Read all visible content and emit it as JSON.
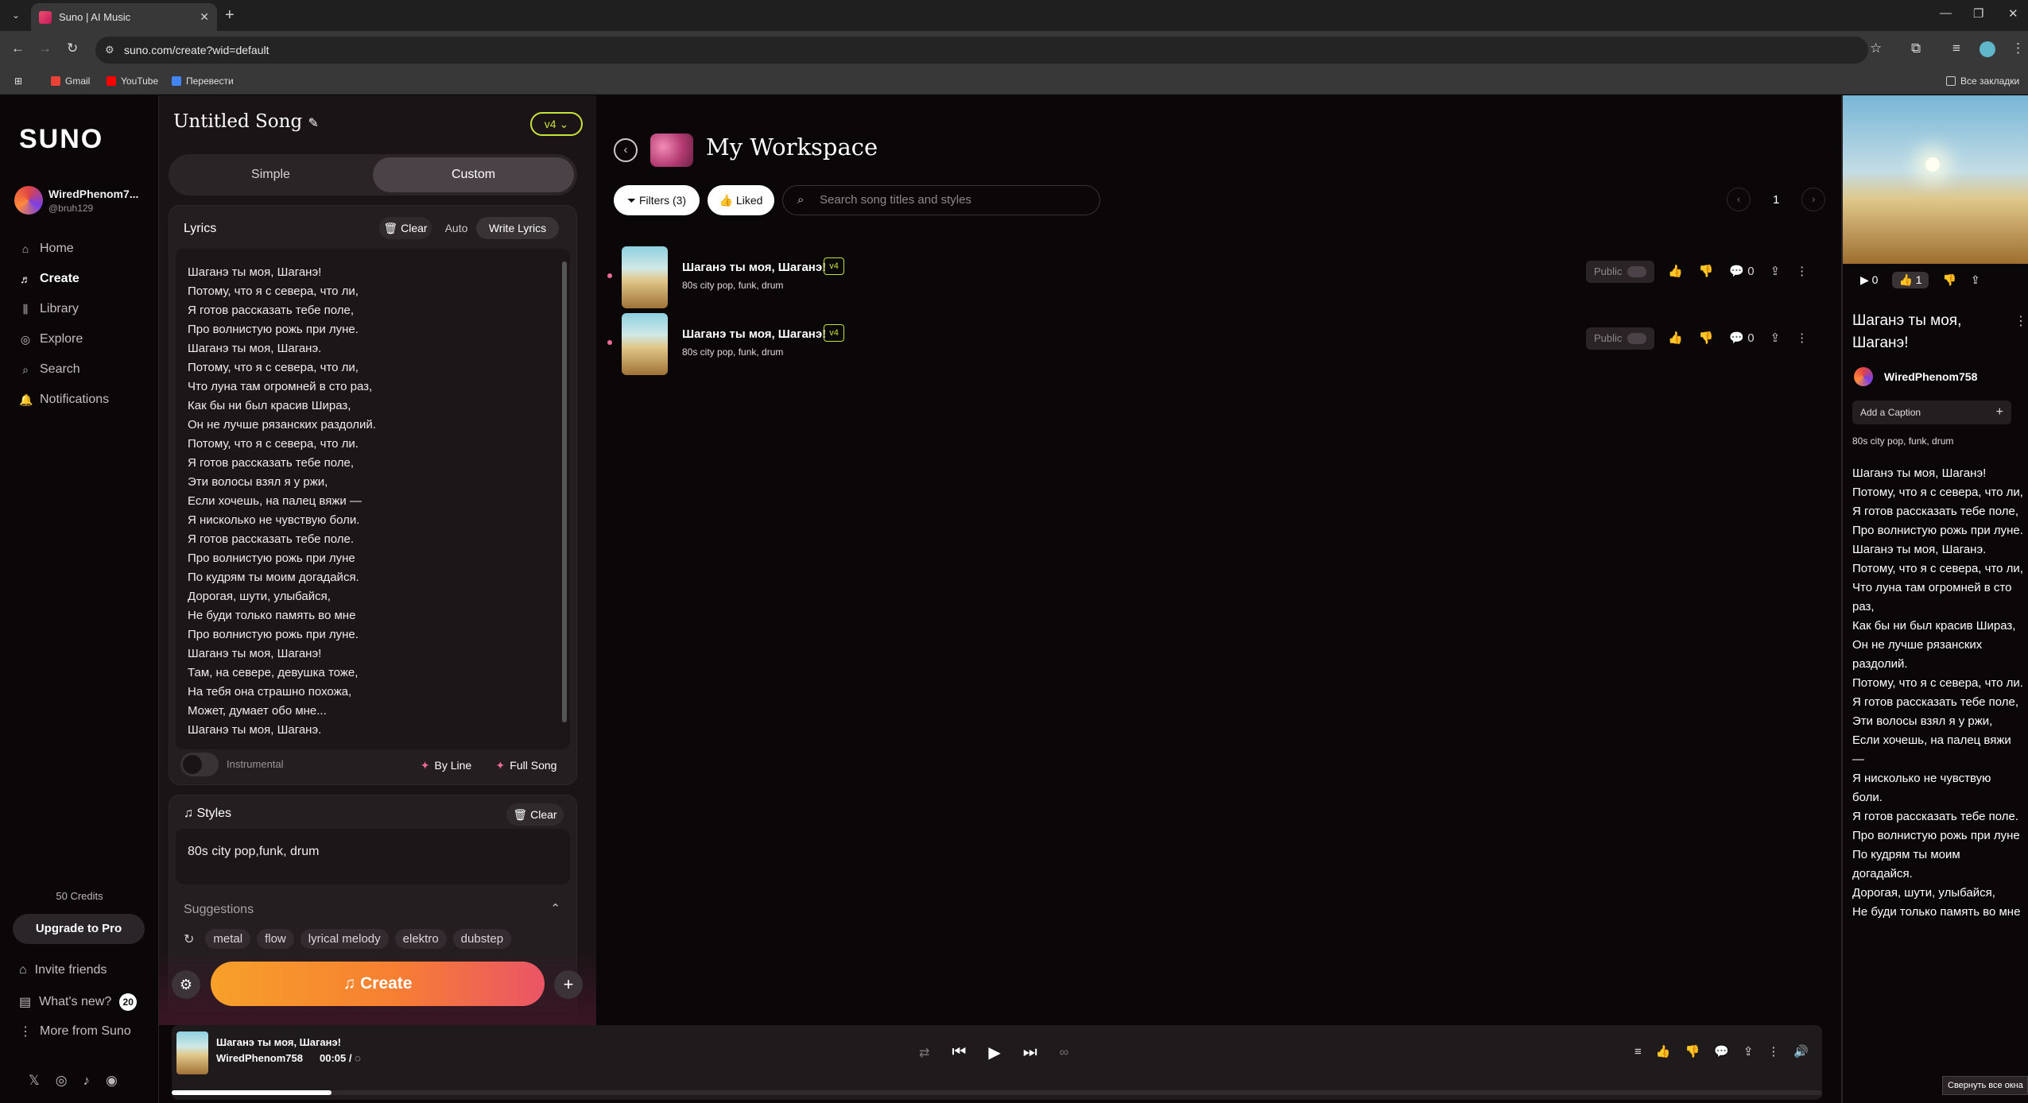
{
  "browser": {
    "tab_title": "Suno | AI Music",
    "tab_close": "✕",
    "new_tab": "+",
    "url": "suno.com/create?wid=default",
    "bookmarks": [
      "Gmail",
      "YouTube",
      "Перевести"
    ],
    "all_bookmarks": "Все закладки",
    "window_buttons": [
      "—",
      "❐",
      "✕"
    ]
  },
  "sidebar": {
    "logo": "SUNO",
    "username": "WiredPhenom7...",
    "handle": "@bruh129",
    "nav": [
      {
        "label": "Home",
        "icon": "⌂"
      },
      {
        "label": "Create",
        "icon": "♬"
      },
      {
        "label": "Library",
        "icon": "⫼"
      },
      {
        "label": "Explore",
        "icon": "◎"
      },
      {
        "label": "Search",
        "icon": "⌕"
      },
      {
        "label": "Notifications",
        "icon": "🔔"
      }
    ],
    "credits": "50 Credits",
    "upgrade": "Upgrade to Pro",
    "invite": "Invite friends",
    "whats_new": "What's new?",
    "whats_new_count": "20",
    "more": "More from Suno",
    "socials": [
      "𝕏",
      "◎",
      "♪",
      "◉"
    ]
  },
  "create": {
    "title": "Untitled Song",
    "version": "v4",
    "mode_simple": "Simple",
    "mode_custom": "Custom",
    "lyrics_label": "Lyrics",
    "clear": "Clear",
    "auto": "Auto",
    "write_lyrics": "Write Lyrics",
    "lyrics": "Шаганэ ты моя, Шаганэ!\nПотому, что я с севера, что ли,\nЯ готов рассказать тебе поле,\nПро волнистую рожь при луне.\nШаганэ ты моя, Шаганэ.\nПотому, что я с севера, что ли,\nЧто луна там огромней в сто раз,\nКак бы ни был красив Шираз,\nОн не лучше рязанских раздолий.\nПотому, что я с севера, что ли.\nЯ готов рассказать тебе поле,\nЭти волосы взял я у ржи,\nЕсли хочешь, на палец вяжи —\nЯ нисколько не чувствую боли.\nЯ готов рассказать тебе поле.\nПро волнистую рожь при луне\nПо кудрям ты моим догадайся.\nДорогая, шути, улыбайся,\nНе буди только память во мне\nПро волнистую рожь при луне.\nШаганэ ты моя, Шаганэ!\nТам, на севере, девушка тоже,\nНа тебя она страшно похожа,\nМожет, думает обо мне...\nШаганэ ты моя, Шаганэ.",
    "instrumental": "Instrumental",
    "by_line": "By Line",
    "full_song": "Full Song",
    "styles_label": "Styles",
    "styles_value": "80s city pop,funk, drum",
    "suggestions": "Suggestions",
    "chips": [
      "metal",
      "flow",
      "lyrical melody",
      "elektro",
      "dubstep"
    ],
    "create_button": "Create"
  },
  "workspace": {
    "title": "My Workspace",
    "filters": "Filters (3)",
    "liked": "Liked",
    "search_placeholder": "Search song titles and styles",
    "page": "1",
    "songs": [
      {
        "title": "Шаганэ ты моя, Шаганэ!",
        "version": "v4",
        "style": "80s city pop, funk, drum",
        "public": "Public",
        "comments": "0"
      },
      {
        "title": "Шаганэ ты моя, Шаганэ!",
        "version": "v4",
        "style": "80s city pop, funk, drum",
        "public": "Public",
        "comments": "0"
      }
    ]
  },
  "detail": {
    "plays": "0",
    "likes": "1",
    "title": "Шаганэ ты моя, Шаганэ!",
    "artist": "WiredPhenom758",
    "caption": "Add a Caption",
    "style": "80s city pop, funk, drum",
    "lyrics": "Шаганэ ты моя, Шаганэ!\nПотому, что я с севера, что ли,\nЯ готов рассказать тебе поле,\nПро волнистую рожь при луне.\nШаганэ ты моя, Шаганэ.\nПотому, что я с севера, что ли,\nЧто луна там огромней в сто раз,\nКак бы ни был красив Шираз,\nОн не лучше рязанских раздолий.\nПотому, что я с севера, что ли.\nЯ готов рассказать тебе поле,\nЭти волосы взял я у ржи,\nЕсли хочешь, на палец вяжи —\nЯ нисколько не чувствую боли.\nЯ готов рассказать тебе поле.\nПро волнистую рожь при луне\nПо кудрям ты моим догадайся.\nДорогая, шути, улыбайся,\nНе буди только память во мне",
    "tooltip": "Свернуть все окна"
  },
  "player": {
    "title": "Шаганэ ты моя, Шаганэ!",
    "artist": "WiredPhenom758",
    "time": "00:05 /",
    "progress_fraction": 0.097
  },
  "colors": {
    "accent": "#c5e43a",
    "create_gradient_start": "#f7a02a",
    "create_gradient_end": "#ea5566",
    "pink": "#f06a9a"
  }
}
